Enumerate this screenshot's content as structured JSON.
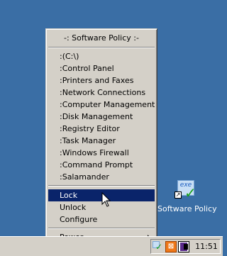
{
  "menu": {
    "title": "-: Software Policy :-",
    "items": [
      ":(C:\\)",
      ":Control Panel",
      ":Printers and Faxes",
      ":Network Connections",
      ":Computer Management",
      ":Disk Management",
      ":Registry Editor",
      ":Task Manager",
      ":Windows Firewall",
      ":Command Prompt",
      ":Salamander"
    ],
    "lock_label": "Lock",
    "unlock_label": "Unlock",
    "configure_label": "Configure",
    "power_label": "Power"
  },
  "desktop_icon": {
    "label": "Software Policy",
    "badge": "exe"
  },
  "tray": {
    "xampp_glyph": "⊠",
    "clock": "11:51"
  },
  "colors": {
    "desktop": "#3a6ea5",
    "menu_face": "#d4d0c8",
    "selection": "#0a246a"
  }
}
